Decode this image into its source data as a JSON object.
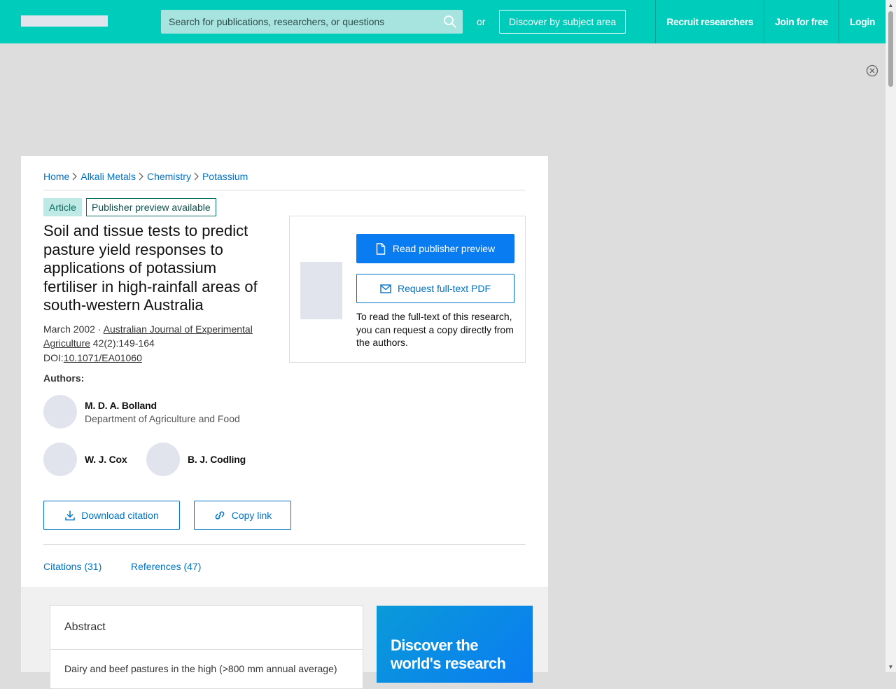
{
  "header": {
    "search_placeholder": "Search for publications, researchers, or questions",
    "or_text": "or",
    "discover_label": "Discover by subject area",
    "nav": [
      "Recruit researchers",
      "Join for free",
      "Login"
    ],
    "accent_color": "#00ccbb"
  },
  "breadcrumb": [
    "Home",
    "Alkali Metals",
    "Chemistry",
    "Potassium"
  ],
  "badges": {
    "type": "Article",
    "preview": "Publisher preview available"
  },
  "paper": {
    "title": "Soil and tissue tests to predict pasture yield responses to applications of potassium fertiliser in high-rainfall areas of south-western Australia",
    "date": "March 2002",
    "date_sep": " · ",
    "journal": "Australian Journal of Experimental Agriculture",
    "issue": " 42(2):149-164",
    "doi_label": "DOI:",
    "doi": "10.1071/EA01060"
  },
  "authors_label": "Authors:",
  "authors": [
    {
      "name": "M. D. A. Bolland",
      "affiliation": "Department of Agriculture and Food"
    },
    {
      "name": "W. J. Cox",
      "affiliation": ""
    },
    {
      "name": "B. J. Codling",
      "affiliation": ""
    }
  ],
  "actions": {
    "download_citation": "Download citation",
    "copy_link": "Copy link"
  },
  "tabs": {
    "citations": "Citations (31)",
    "references": "References (47)"
  },
  "preview": {
    "read_label": "Read publisher preview",
    "request_label": "Request full-text PDF",
    "note": "To read the full-text of this research, you can request a copy directly from the authors."
  },
  "abstract": {
    "title": "Abstract",
    "text": "Dairy and beef pastures in the high (>800 mm annual average)"
  },
  "promo": {
    "text": "Discover the world's research"
  },
  "icons": {
    "search": "search-icon",
    "close": "close-circle-icon",
    "chevron": "chevron-right-icon",
    "file": "file-icon",
    "mail": "mail-icon",
    "download": "download-icon",
    "link": "link-icon"
  }
}
